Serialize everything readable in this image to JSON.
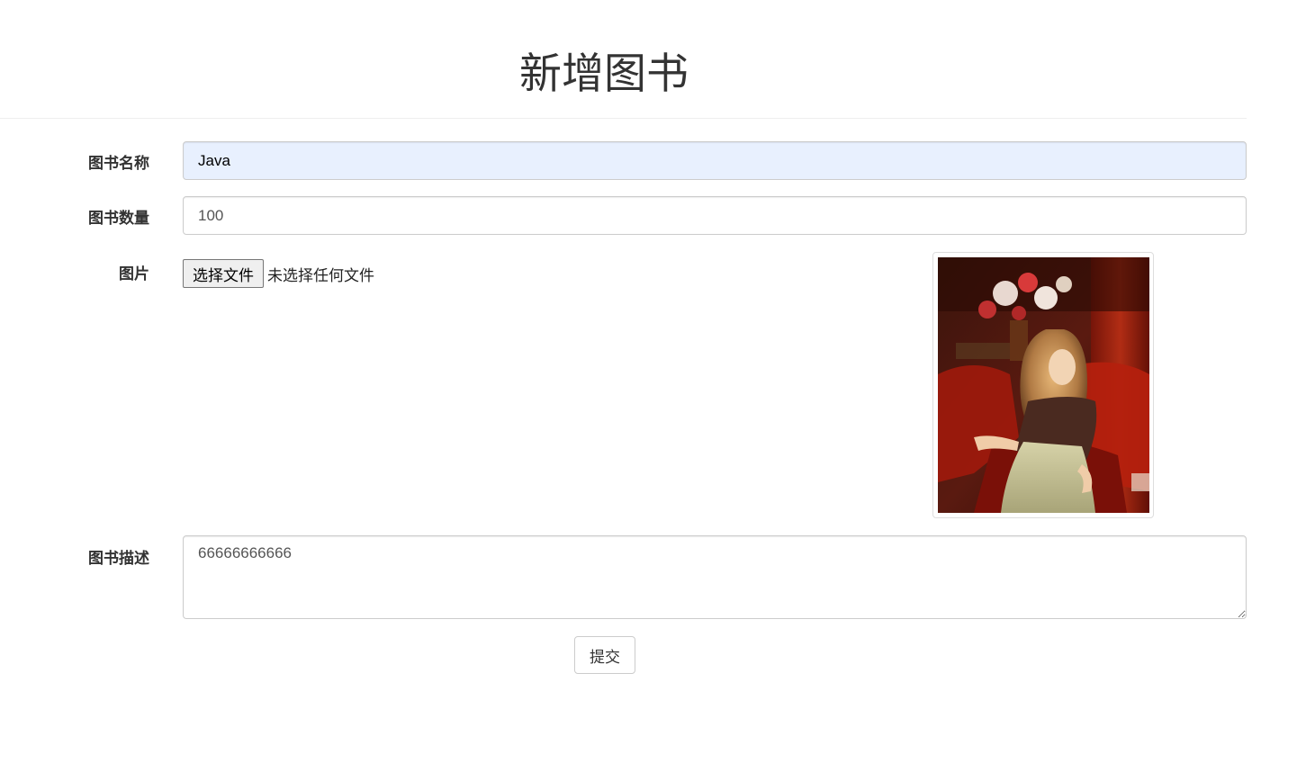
{
  "page": {
    "title": "新增图书"
  },
  "form": {
    "name": {
      "label": "图书名称",
      "value": "Java"
    },
    "quantity": {
      "label": "图书数量",
      "value": "100"
    },
    "image": {
      "label": "图片",
      "choose_button": "选择文件",
      "status": "未选择任何文件"
    },
    "description": {
      "label": "图书描述",
      "value": "66666666666"
    },
    "submit_label": "提交"
  },
  "colors": {
    "autofill_background": "#e8f0fe",
    "input_border": "#cccccc",
    "text": "#333333"
  }
}
